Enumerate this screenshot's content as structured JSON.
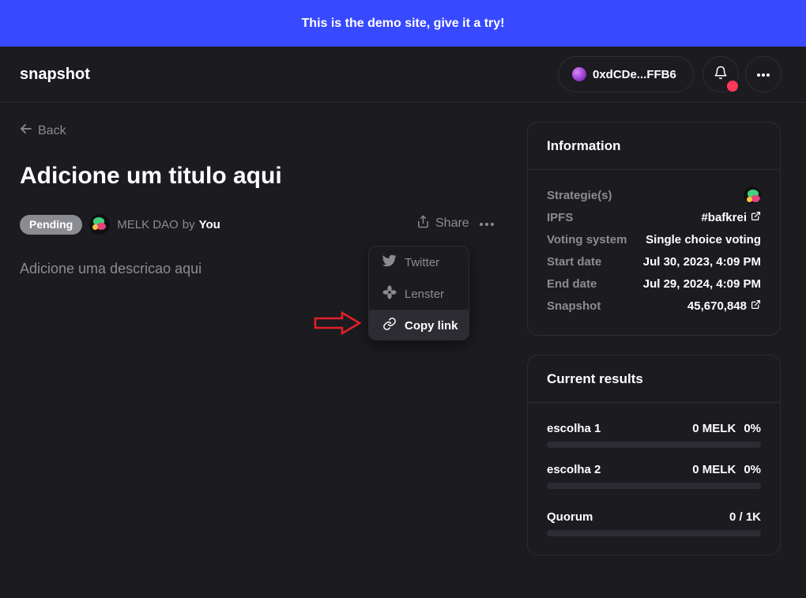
{
  "banner": {
    "text": "This is the demo site, give it a try!"
  },
  "header": {
    "brand": "snapshot",
    "account": "0xdCDe...FFB6",
    "bell_icon": "bell-icon",
    "menu_icon": "more-horizontal-icon"
  },
  "proposal": {
    "back_label": "Back",
    "title": "Adicione um titulo aqui",
    "status": "Pending",
    "space": "MELK DAO",
    "by": "by",
    "author": "You",
    "share_label": "Share",
    "description": "Adicione uma descricao aqui"
  },
  "share_menu": {
    "items": [
      {
        "label": "Twitter",
        "icon": "twitter-icon"
      },
      {
        "label": "Lenster",
        "icon": "lenster-icon"
      },
      {
        "label": "Copy link",
        "icon": "link-icon"
      }
    ]
  },
  "information": {
    "title": "Information",
    "rows": [
      {
        "key": "Strategie(s)",
        "value": ""
      },
      {
        "key": "IPFS",
        "value": "#bafkrei"
      },
      {
        "key": "Voting system",
        "value": "Single choice voting"
      },
      {
        "key": "Start date",
        "value": "Jul 30, 2023, 4:09 PM"
      },
      {
        "key": "End date",
        "value": "Jul 29, 2024, 4:09 PM"
      },
      {
        "key": "Snapshot",
        "value": "45,670,848"
      }
    ]
  },
  "results": {
    "title": "Current results",
    "choices": [
      {
        "label": "escolha 1",
        "amount": "0 MELK",
        "percent": "0%",
        "fraction": 0
      },
      {
        "label": "escolha 2",
        "amount": "0 MELK",
        "percent": "0%",
        "fraction": 0
      }
    ],
    "quorum": {
      "label": "Quorum",
      "value": "0 / 1K",
      "fraction": 0
    }
  },
  "colors": {
    "background": "#1c1b20",
    "accent": "#384aff",
    "border": "#2d2c33",
    "muted_text": "#8b8c91",
    "notification": "#ff3856",
    "annotation_arrow": "#e0202a"
  }
}
